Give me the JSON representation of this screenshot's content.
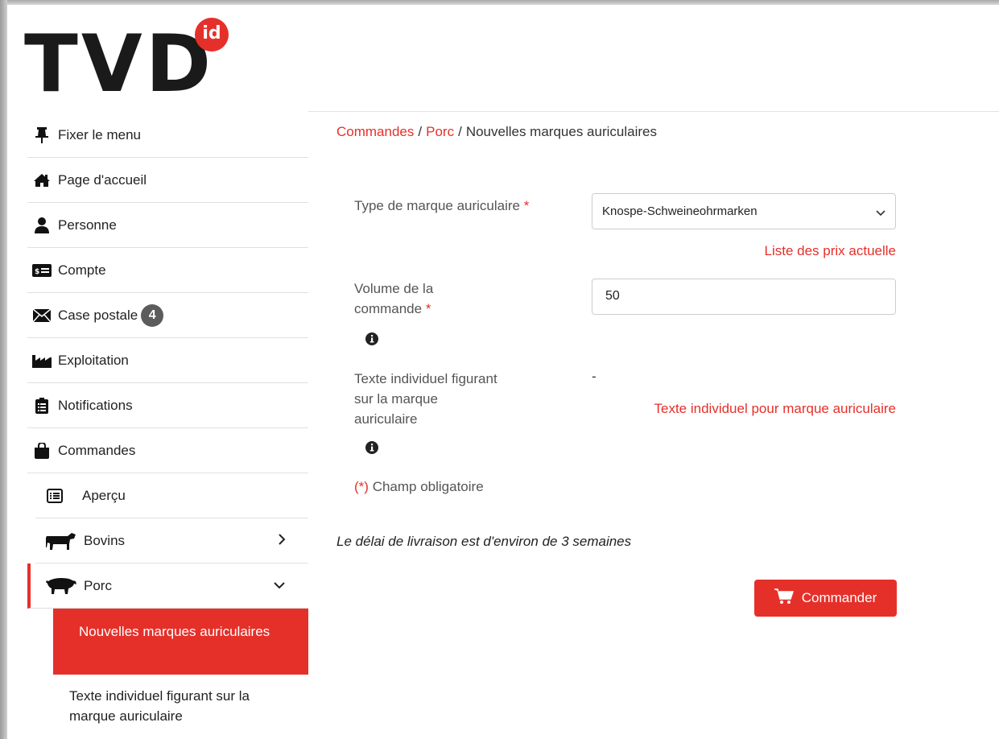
{
  "logo": {
    "text": "TVD",
    "badge": "id"
  },
  "breadcrumb": {
    "items": [
      {
        "label": "Commandes"
      },
      {
        "label": "Porc"
      },
      {
        "label": "Nouvelles marques auriculaires"
      }
    ],
    "separator": "/"
  },
  "sidebar": {
    "fix_menu": "Fixer le menu",
    "home": "Page d'accueil",
    "person": "Personne",
    "account": "Compte",
    "mailbox": "Case postale",
    "mailbox_count": "4",
    "farm": "Exploitation",
    "notifications": "Notifications",
    "orders": "Commandes",
    "overview": "Aperçu",
    "cattle": "Bovins",
    "pig": "Porc",
    "new_tags": "Nouvelles marques auriculaires",
    "individual_text": "Texte individuel figurant sur la marque auriculaire"
  },
  "form": {
    "tag_type_label": "Type de marque auriculaire",
    "required_mark": "*",
    "tag_type_value": "Knospe-Schweineohrmarken",
    "price_list_link": "Liste des prix actuelle",
    "volume_label_line1": "Volume de la",
    "volume_label_line2": "commande",
    "volume_value": "50",
    "text_label_line1": "Texte individuel figurant",
    "text_label_line2": "sur la marque",
    "text_label_line3": "auriculaire",
    "text_value": "-",
    "text_link": "Texte individuel pour marque auriculaire",
    "required_note_mark": "(*)",
    "required_note": "Champ obligatoire"
  },
  "delivery_note": "Le délai de livraison est d'environ de 3 semaines",
  "order_button": "Commander",
  "colors": {
    "accent": "#e5302a",
    "badge": "#5c5c5c"
  }
}
